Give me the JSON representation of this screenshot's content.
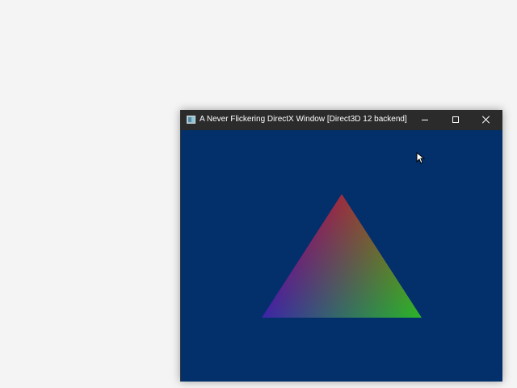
{
  "window": {
    "title": "A Never Flickering DirectX Window [Direct3D 12 backend]",
    "controls": {
      "minimize_icon": "minimize-icon",
      "maximize_icon": "maximize-icon",
      "close_icon": "close-icon"
    }
  },
  "scene": {
    "background_color": "#03306a",
    "triangle": {
      "vertex_colors": [
        "#ff0000",
        "#00ff00",
        "#0000ff"
      ]
    }
  },
  "colors": {
    "titlebar": "#2b2b2b",
    "desktop": "#f4f4f4"
  }
}
